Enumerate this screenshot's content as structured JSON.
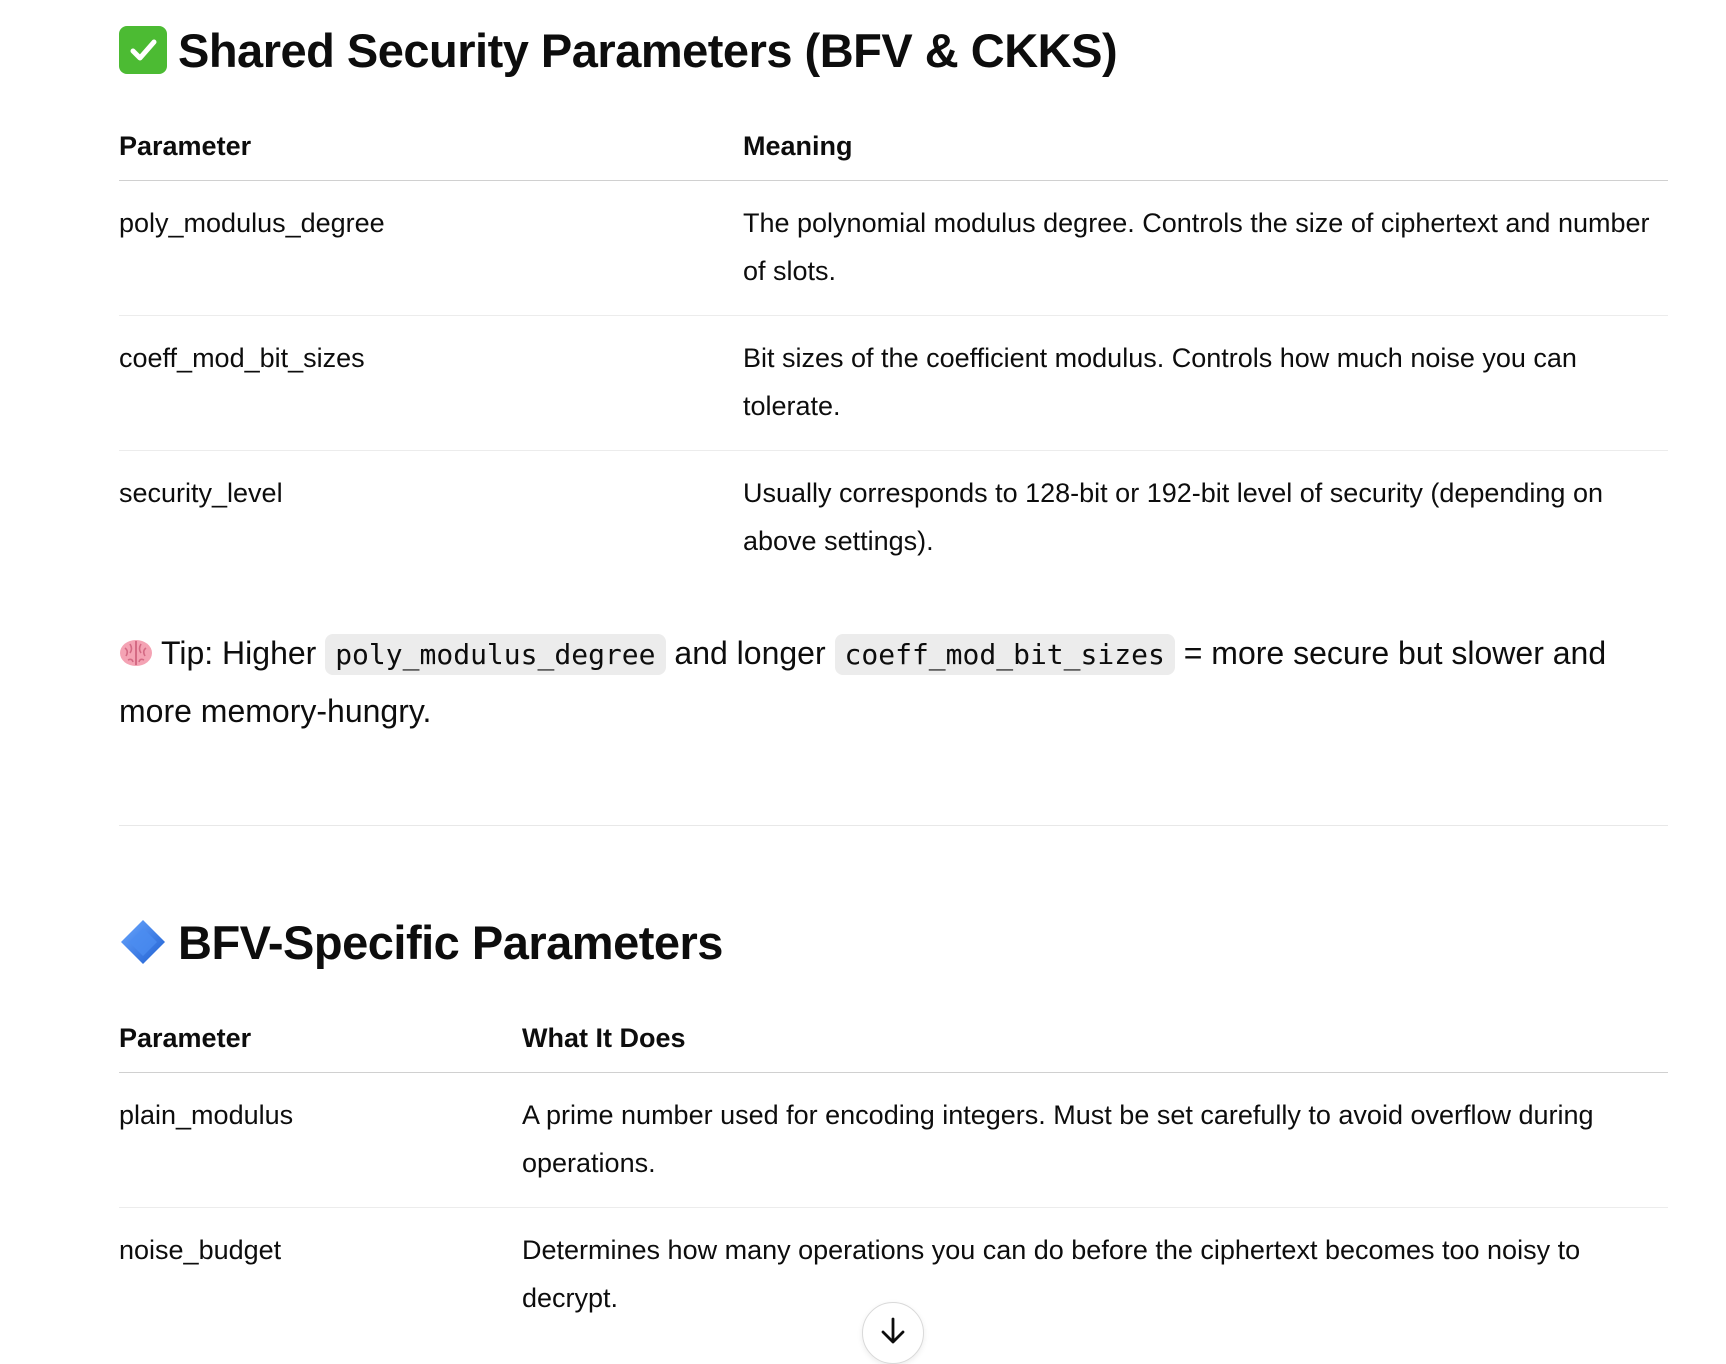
{
  "section1": {
    "title": "Shared Security Parameters (BFV & CKKS)",
    "icon": "check-mark-button-emoji",
    "headers": [
      "Parameter",
      "Meaning"
    ],
    "rows": [
      {
        "param": "poly_modulus_degree",
        "desc": "The polynomial modulus degree. Controls the size of ciphertext and number of slots."
      },
      {
        "param": "coeff_mod_bit_sizes",
        "desc": "Bit sizes of the coefficient modulus. Controls how much noise you can tolerate."
      },
      {
        "param": "security_level",
        "desc": "Usually corresponds to 128-bit or 192-bit level of security (depending on above settings)."
      }
    ]
  },
  "tip": {
    "icon": "brain-emoji",
    "prefix": "Tip: Higher",
    "code1": "poly_modulus_degree",
    "middle": "and longer",
    "code2": "coeff_mod_bit_sizes",
    "suffix": "= more secure but slower and more memory-hungry."
  },
  "section2": {
    "title": "BFV-Specific Parameters",
    "icon": "blue-diamond-emoji",
    "headers": [
      "Parameter",
      "What It Does"
    ],
    "rows": [
      {
        "param": "plain_modulus",
        "desc": "A prime number used for encoding integers. Must be set carefully to avoid overflow during operations."
      },
      {
        "param": "noise_budget",
        "desc": "Determines how many operations you can do before the ciphertext becomes too noisy to decrypt."
      }
    ]
  },
  "scroll_button": {
    "icon": "arrow-down-icon"
  }
}
